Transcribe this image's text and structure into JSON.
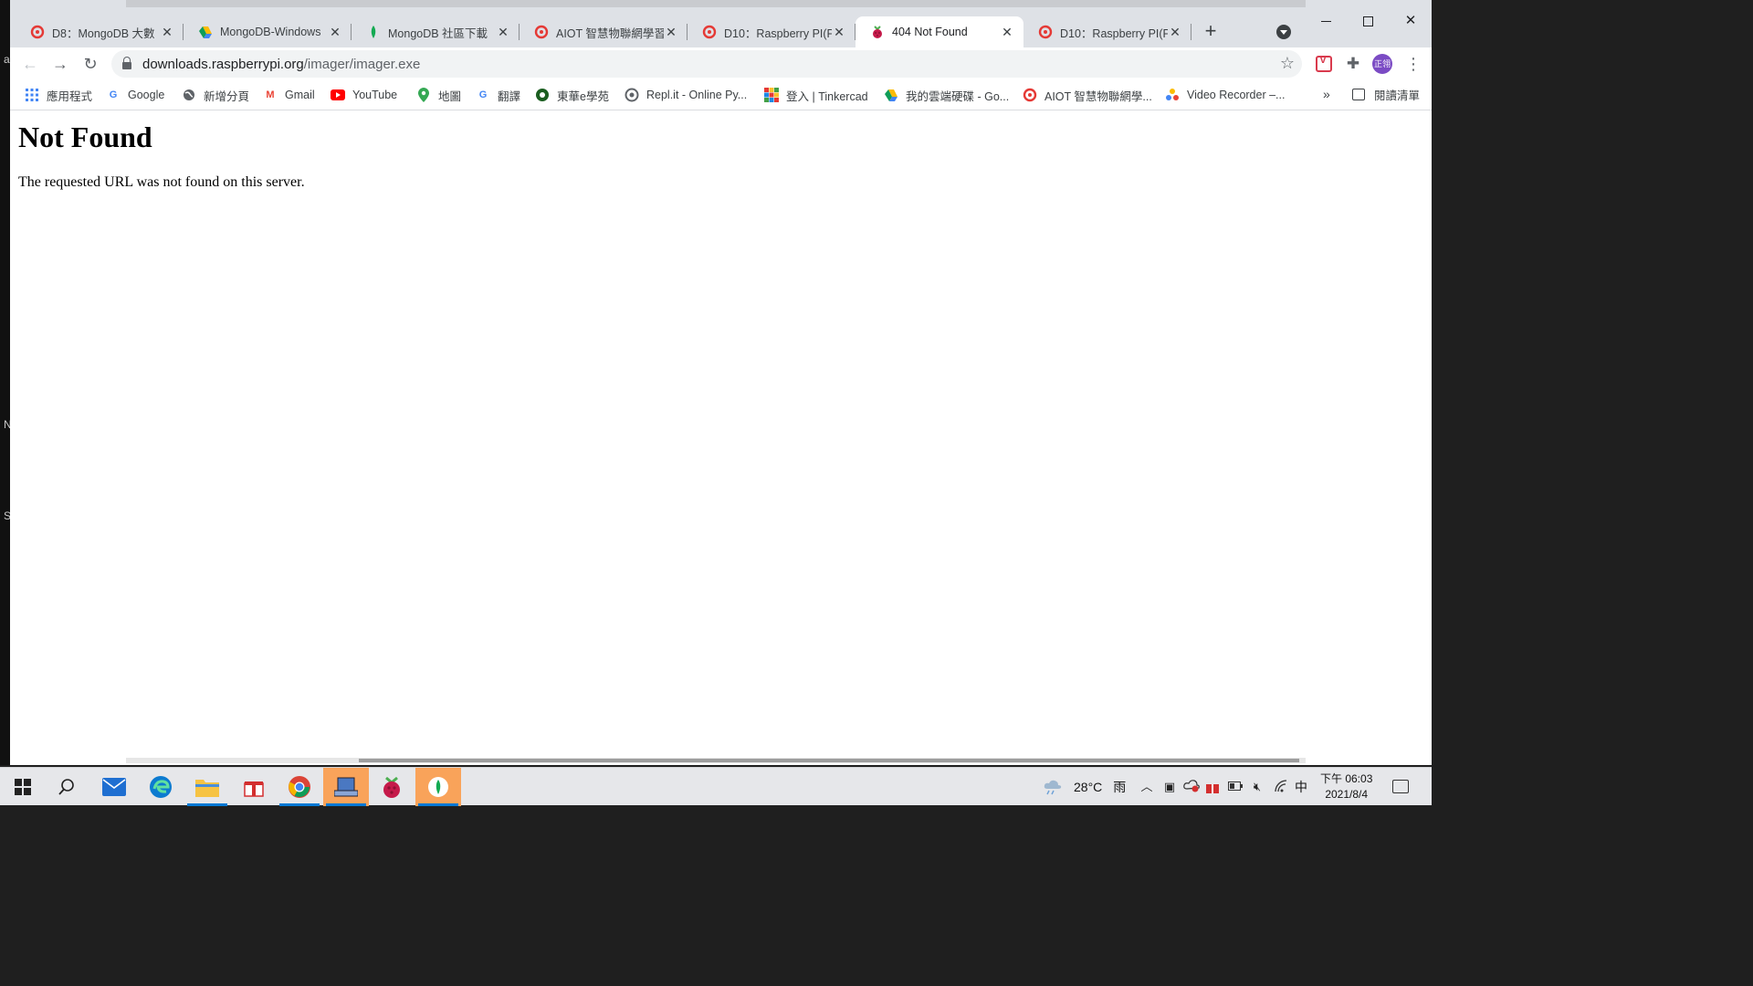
{
  "left_strip": {
    "letters": [
      "a",
      "N",
      "S"
    ]
  },
  "browser": {
    "tabs": [
      {
        "title": "D8：MongoDB 大數",
        "favicon": "aiot-red-icon",
        "active": false
      },
      {
        "title": "MongoDB-Windows",
        "favicon": "google-drive-icon",
        "active": false
      },
      {
        "title": "MongoDB 社區下載",
        "favicon": "mongodb-leaf-icon",
        "active": false
      },
      {
        "title": "AIOT 智慧物聯網學習",
        "favicon": "aiot-red-icon",
        "active": false
      },
      {
        "title": "D10：Raspberry PI(P",
        "favicon": "aiot-red-icon",
        "active": false
      },
      {
        "title": "404 Not Found",
        "favicon": "raspberry-icon",
        "active": true
      },
      {
        "title": "D10：Raspberry PI(P",
        "favicon": "aiot-red-icon",
        "active": false
      }
    ],
    "new_tab_label": "+",
    "address": {
      "host": "downloads.raspberrypi.org",
      "path": "/imager/imager.exe"
    },
    "avatar_text": "正翎",
    "bookmarks": [
      {
        "label": "應用程式",
        "icon": "apps-grid-icon"
      },
      {
        "label": "Google",
        "icon": "google-g-icon"
      },
      {
        "label": "新增分頁",
        "icon": "globe-icon"
      },
      {
        "label": "Gmail",
        "icon": "gmail-icon"
      },
      {
        "label": "YouTube",
        "icon": "youtube-icon"
      },
      {
        "label": "地圖",
        "icon": "maps-pin-icon"
      },
      {
        "label": "翻譯",
        "icon": "translate-icon"
      },
      {
        "label": "東華e學苑",
        "icon": "ndhu-icon"
      },
      {
        "label": "Repl.it - Online Py...",
        "icon": "replit-icon"
      },
      {
        "label": "登入 | Tinkercad",
        "icon": "tinkercad-icon"
      },
      {
        "label": "我的雲端硬碟 - Go...",
        "icon": "google-drive-icon"
      },
      {
        "label": "AIOT 智慧物聯網學...",
        "icon": "aiot-red-icon"
      },
      {
        "label": "Video Recorder –...",
        "icon": "video-recorder-icon"
      }
    ],
    "bookmarks_overflow": "»",
    "reading_list_label": "閱讀清單"
  },
  "page": {
    "heading": "Not Found",
    "message": "The requested URL was not found on this server."
  },
  "taskbar": {
    "apps": [
      "start",
      "search",
      "mail",
      "edge",
      "file-explorer",
      "gift",
      "chrome",
      "network-tool",
      "raspberry-pi-imager",
      "mongodb-compass"
    ],
    "weather_temp": "28°C",
    "weather_desc": "雨",
    "ime": "中",
    "time": "下午 06:03",
    "date": "2021/8/4"
  },
  "colors": {
    "tabstrip_bg": "#dee1e6",
    "aiot_red": "#e53935",
    "mongodb_green": "#13aa52",
    "raspberry_red": "#c51a4a",
    "avatar_purple": "#7b4bc4",
    "taskbar_orange": "#f9a35a",
    "windows_blue": "#0078d4"
  }
}
